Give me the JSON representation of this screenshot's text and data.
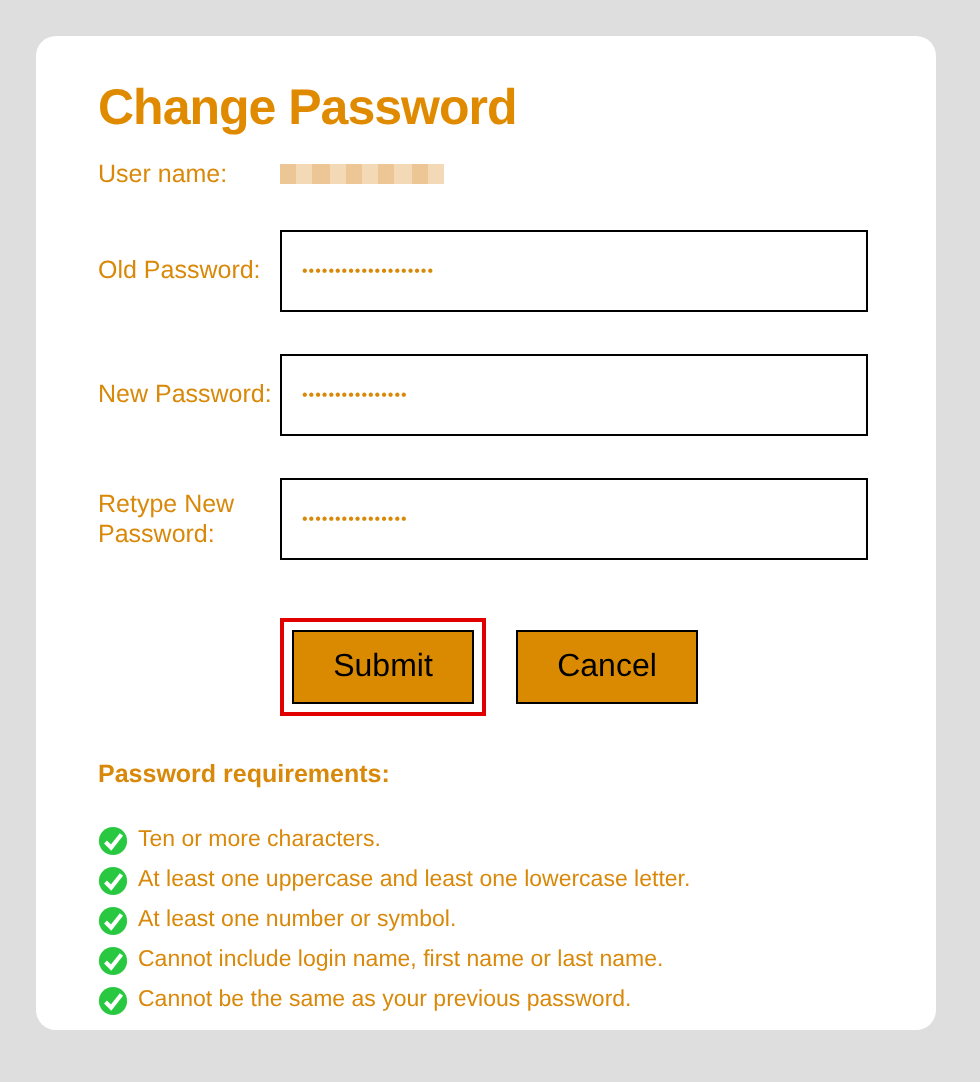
{
  "title": "Change Password",
  "user": {
    "label": "User name:"
  },
  "fields": [
    {
      "label": "Old Password:",
      "value": "••••••••••••••••••••"
    },
    {
      "label": "New Password:",
      "value": "••••••••••••••••"
    },
    {
      "label": "Retype New Password:",
      "value": "••••••••••••••••"
    }
  ],
  "buttons": [
    {
      "label": "Submit",
      "focused": true
    },
    {
      "label": "Cancel",
      "focused": false
    }
  ],
  "requirements_title": "Password requirements:",
  "requirements": [
    {
      "text": "Ten or more characters.",
      "met": true
    },
    {
      "text": "At least one uppercase and least one lowercase letter.",
      "met": true
    },
    {
      "text": "At least one number or symbol.",
      "met": true
    },
    {
      "text": "Cannot include login name, first name or last name.",
      "met": true
    },
    {
      "text": "Cannot be the same as your previous password.",
      "met": true
    }
  ]
}
